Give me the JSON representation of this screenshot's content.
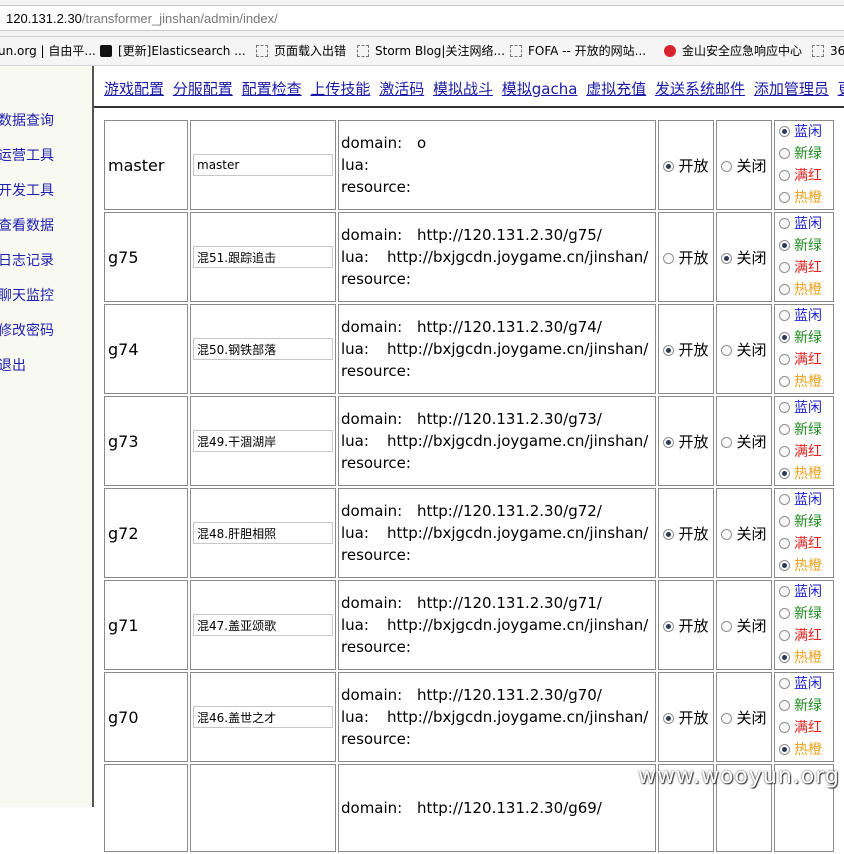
{
  "browser": {
    "url_host": "120.131.2.30",
    "url_path": "/transformer_jinshan/admin/index/",
    "bookmarks": [
      {
        "label": "un.org | 自由平...",
        "icon": "none"
      },
      {
        "label": "[更新]Elasticsearch ...",
        "icon": "bookmark-icon"
      },
      {
        "label": "页面载入出错",
        "icon": "page-icon"
      },
      {
        "label": "Storm Blog|关注网络...",
        "icon": "page-icon"
      },
      {
        "label": "FOFA -- 开放的网站...",
        "icon": "page-icon"
      },
      {
        "label": "金山安全应急响应中心",
        "icon": "kingsoft-icon"
      },
      {
        "label": "36",
        "icon": "page-icon"
      }
    ]
  },
  "sidebar": {
    "items": [
      {
        "label": "数据查询"
      },
      {
        "label": "运营工具"
      },
      {
        "label": "开发工具"
      },
      {
        "label": "查看数据"
      },
      {
        "label": "日志记录"
      },
      {
        "label": "聊天监控"
      },
      {
        "label": "修改密码"
      },
      {
        "label": "退出"
      }
    ]
  },
  "topnav": {
    "items": [
      {
        "label": "游戏配置"
      },
      {
        "label": "分服配置"
      },
      {
        "label": "配置检查"
      },
      {
        "label": "上传技能"
      },
      {
        "label": "激活码"
      },
      {
        "label": "模拟战斗"
      },
      {
        "label": "模拟gacha"
      },
      {
        "label": "虚拟充值"
      },
      {
        "label": "发送系统邮件"
      },
      {
        "label": "添加管理员"
      },
      {
        "label": "更"
      }
    ]
  },
  "table": {
    "labels": {
      "domain": "domain:",
      "lua": "lua:",
      "resource": "resource:",
      "open": "开放",
      "close": "关闭",
      "tag_blue": "蓝闲",
      "tag_green": "新绿",
      "tag_red": "满红",
      "tag_orange": "热橙"
    },
    "rows": [
      {
        "id": "master",
        "name": "master",
        "domain": "o",
        "lua": "",
        "status": "open",
        "tag": "blue"
      },
      {
        "id": "g75",
        "name": "混51.跟踪追击",
        "domain": "http://120.131.2.30/g75/",
        "lua": "http://bxjgcdn.joygame.cn/jinshan/",
        "status": "close",
        "tag": "green"
      },
      {
        "id": "g74",
        "name": "混50.钢铁部落",
        "domain": "http://120.131.2.30/g74/",
        "lua": "http://bxjgcdn.joygame.cn/jinshan/",
        "status": "open",
        "tag": "green"
      },
      {
        "id": "g73",
        "name": "混49.干涸湖岸",
        "domain": "http://120.131.2.30/g73/",
        "lua": "http://bxjgcdn.joygame.cn/jinshan/",
        "status": "open",
        "tag": "orange"
      },
      {
        "id": "g72",
        "name": "混48.肝胆相照",
        "domain": "http://120.131.2.30/g72/",
        "lua": "http://bxjgcdn.joygame.cn/jinshan/",
        "status": "open",
        "tag": "orange"
      },
      {
        "id": "g71",
        "name": "混47.盖亚颂歌",
        "domain": "http://120.131.2.30/g71/",
        "lua": "http://bxjgcdn.joygame.cn/jinshan/",
        "status": "open",
        "tag": "orange"
      },
      {
        "id": "g70",
        "name": "混46.盖世之才",
        "domain": "http://120.131.2.30/g70/",
        "lua": "http://bxjgcdn.joygame.cn/jinshan/",
        "status": "open",
        "tag": "orange"
      },
      {
        "id": "",
        "name": "",
        "domain": "http://120.131.2.30/g69/",
        "lua": "",
        "status": "",
        "tag": ""
      }
    ]
  },
  "watermark": "www.wooyun.org",
  "colors": {
    "link": "#1a1aa6",
    "blue": "#1f1fd0",
    "green": "#1e8a1e",
    "red": "#e0221d",
    "orange": "#f0a220"
  }
}
